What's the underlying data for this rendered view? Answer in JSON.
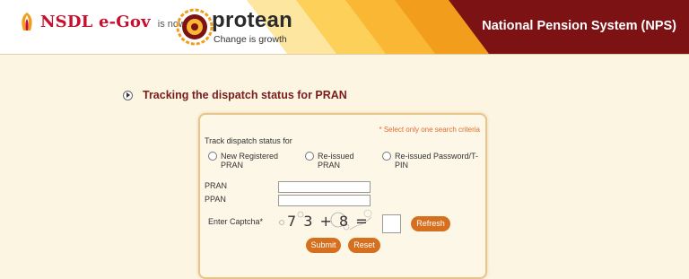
{
  "header": {
    "nsdl_logo_text": "NSDL e-Gov",
    "is_now": "is now",
    "protean_name": "protean",
    "protean_tagline": "Change is growth",
    "system_title": "National Pension System (NPS)",
    "colors": {
      "stripe_light": "#fdd05a",
      "stripe_mid": "#f9b733",
      "stripe_dark": "#f29e1c",
      "maroon": "#7d1214"
    }
  },
  "page": {
    "section_title": "Tracking the dispatch status for PRAN"
  },
  "form": {
    "note": "* Select only one search criteria",
    "track_label": "Track dispatch status for",
    "options": [
      {
        "label": "New Registered PRAN"
      },
      {
        "label": "Re-issued PRAN"
      },
      {
        "label": "Re-issued Password/T-PIN"
      }
    ],
    "pran_label": "PRAN",
    "ppan_label": "PPAN",
    "captcha_label": "Enter Captcha*",
    "captcha_text": "7 3 + 8 =",
    "refresh_label": "Refresh",
    "submit_label": "Submit",
    "reset_label": "Reset"
  }
}
